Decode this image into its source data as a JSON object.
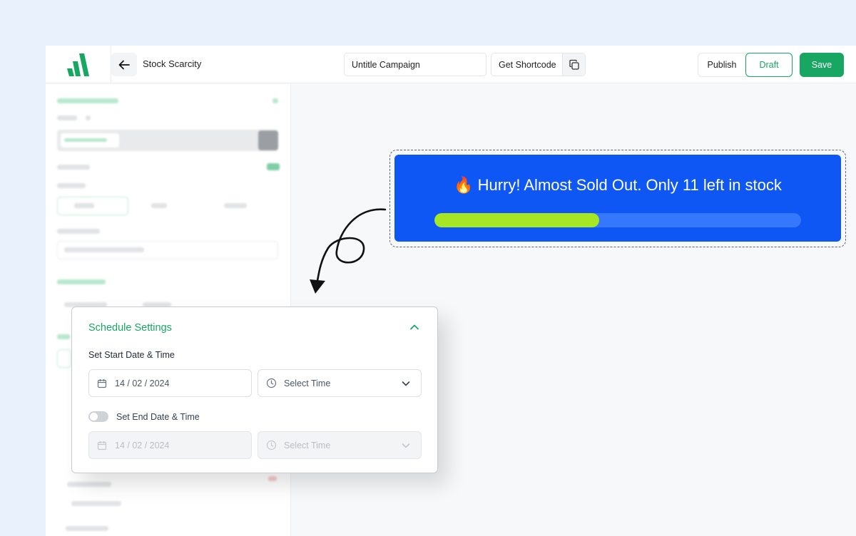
{
  "header": {
    "page_title": "Stock Scarcity",
    "campaign_name": "Untitle Campaign",
    "shortcode_label": "Get Shortcode",
    "publish_label": "Publish",
    "draft_label": "Draft",
    "save_label": "Save",
    "brand_color": "#18a763"
  },
  "preview": {
    "message": "🔥 Hurry! Almost Sold Out. Only 11 left in stock",
    "progress_fraction": 0.45,
    "banner_color": "#0f57f5",
    "bar_color": "#a5e625"
  },
  "schedule": {
    "title": "Schedule Settings",
    "start_label": "Set Start Date & Time",
    "start_date": "14 / 02 / 2024",
    "start_time_placeholder": "Select Time",
    "end_label": "Set End Date & Time",
    "end_enabled": false,
    "end_date": "14 / 02 / 2024",
    "end_time_placeholder": "Select Time"
  }
}
